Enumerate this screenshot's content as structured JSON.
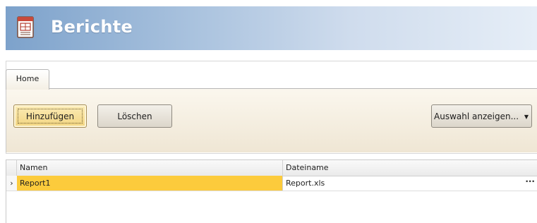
{
  "header": {
    "title": "Berichte",
    "icon": "report-document-icon"
  },
  "ribbon": {
    "tabs": [
      {
        "label": "Home",
        "active": true
      }
    ],
    "buttons": {
      "add_label": "Hinzufügen",
      "delete_label": "Löschen",
      "show_selection_label": "Auswahl anzeigen...",
      "show_selection_caret": "chevron-down-icon"
    }
  },
  "grid": {
    "columns": [
      "Namen",
      "Dateiname"
    ],
    "rows": [
      {
        "indicator": "›",
        "name": "Report1",
        "file": "Report.xls",
        "ellipsis": "···",
        "selected": true
      }
    ]
  },
  "colors": {
    "header_gradient_start": "#7da2cb",
    "selected_cell": "#fccb3c",
    "ribbon_panel": "#f3ecdc",
    "add_button": "#f2d480"
  }
}
